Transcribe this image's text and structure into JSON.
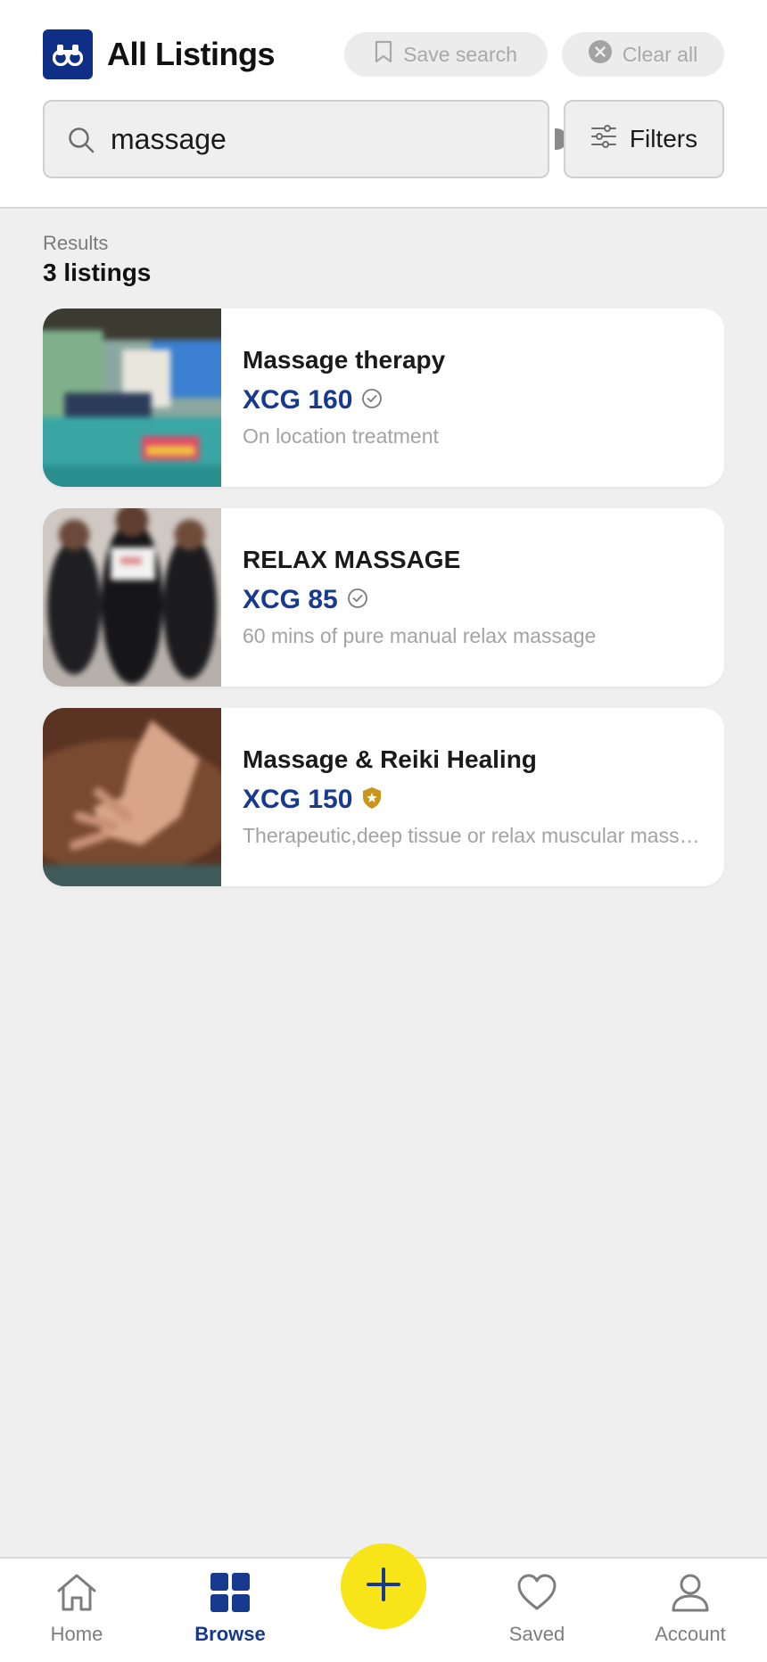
{
  "header": {
    "title": "All Listings",
    "logo_icon": "binoculars-icon",
    "save_search_label": "Save search",
    "clear_all_label": "Clear all"
  },
  "search": {
    "value": "massage",
    "placeholder": "",
    "filters_label": "Filters"
  },
  "results": {
    "label": "Results",
    "count_text": "3 listings"
  },
  "listings": [
    {
      "title": "Massage therapy",
      "price": "XCG 160",
      "badge": "verified-check-icon",
      "description": "On location treatment"
    },
    {
      "title": "RELAX MASSAGE",
      "price": "XCG 85",
      "badge": "verified-check-icon",
      "description": "60 mins of pure manual relax massage"
    },
    {
      "title": "Massage & Reiki Healing",
      "price": "XCG 150",
      "badge": "gold-star-shield-icon",
      "description": "Therapeutic,deep tissue or relax muscular massage"
    }
  ],
  "nav": {
    "home": "Home",
    "browse": "Browse",
    "saved": "Saved",
    "account": "Account",
    "active": "browse"
  },
  "colors": {
    "brand_blue": "#173a8f",
    "logo_blue": "#0f2f86",
    "fab_yellow": "#f7e51a",
    "gold_badge": "#c8961a"
  }
}
